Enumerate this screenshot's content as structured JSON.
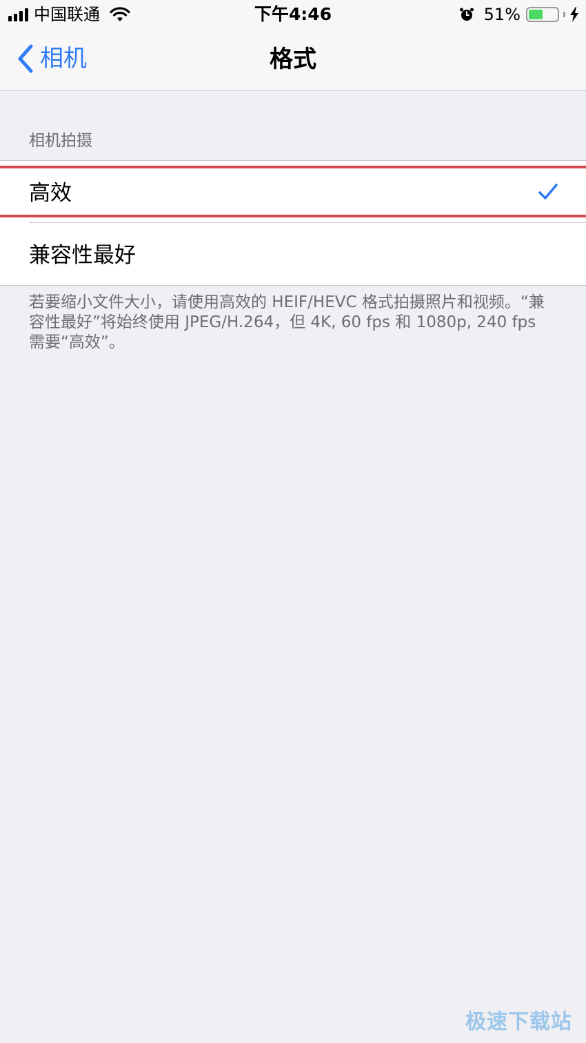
{
  "status_bar": {
    "carrier": "中国联通",
    "time": "下午4:46",
    "battery_percent": "51%",
    "battery_level": 0.51,
    "battery_color": "#4cd964",
    "icons": [
      "signal-icon",
      "wifi-icon",
      "alarm-icon",
      "battery-icon",
      "charging-bolt-icon"
    ]
  },
  "nav": {
    "back_label": "相机",
    "title": "格式",
    "accent": "#2f7bf5"
  },
  "section": {
    "header": "相机拍摄",
    "options": [
      {
        "label": "高效",
        "selected": true
      },
      {
        "label": "兼容性最好",
        "selected": false
      }
    ],
    "footer": "若要缩小文件大小，请使用高效的 HEIF/HEVC 格式拍摄照片和视频。“兼容性最好”将始终使用 JPEG/H.264，但 4K, 60 fps 和 1080p, 240 fps 需要“高效”。"
  },
  "highlight_color": "#d24b50",
  "watermark": "极速下载站"
}
